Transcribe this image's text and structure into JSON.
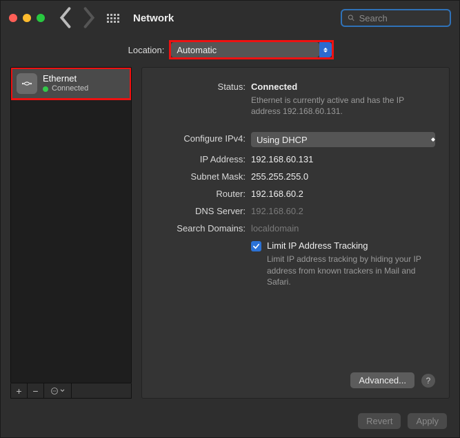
{
  "titlebar": {
    "title": "Network",
    "search_placeholder": "Search"
  },
  "location": {
    "label": "Location:",
    "value": "Automatic"
  },
  "sidebar": {
    "services": [
      {
        "name": "Ethernet",
        "status": "Connected",
        "status_color": "#34c84a"
      }
    ],
    "tool_labels": {
      "add": "+",
      "remove": "−",
      "more": "⋯"
    }
  },
  "detail": {
    "status_label": "Status:",
    "status_value": "Connected",
    "status_desc": "Ethernet is currently active and has the IP address 192.168.60.131.",
    "configure_label": "Configure IPv4:",
    "configure_value": "Using DHCP",
    "ip_label": "IP Address:",
    "ip_value": "192.168.60.131",
    "subnet_label": "Subnet Mask:",
    "subnet_value": "255.255.255.0",
    "router_label": "Router:",
    "router_value": "192.168.60.2",
    "dns_label": "DNS Server:",
    "dns_value": "192.168.60.2",
    "search_label": "Search Domains:",
    "search_value": "localdomain",
    "limit_label": "Limit IP Address Tracking",
    "limit_desc": "Limit IP address tracking by hiding your IP address from known trackers in Mail and Safari.",
    "advanced": "Advanced...",
    "help": "?"
  },
  "footer": {
    "revert": "Revert",
    "apply": "Apply"
  }
}
